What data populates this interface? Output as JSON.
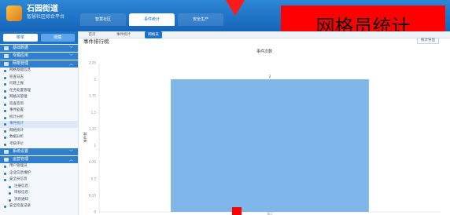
{
  "header": {
    "app_title": "石园街道",
    "app_subtitle": "智慧社区综合平台",
    "nav": [
      "智慧社区",
      "事件统计",
      "安全生产"
    ],
    "active_nav": 1
  },
  "overlay": {
    "banner_text": "网格员统计",
    "banner_color": "#ff0000"
  },
  "sidebar": {
    "tabs": [
      "菜单",
      "收藏"
    ],
    "sections": [
      {
        "title": "基础数据",
        "items": []
      },
      {
        "title": "专题应用",
        "items": []
      },
      {
        "title": "网格管理",
        "items": [
          {
            "label": "网格基础信息"
          },
          {
            "label": "巡查日志"
          },
          {
            "label": "问题上报"
          },
          {
            "label": "任务处置管理"
          },
          {
            "label": "网格员管理"
          },
          {
            "label": "巡查签到"
          },
          {
            "label": "事件处置"
          },
          {
            "label": "统计分析"
          },
          {
            "label": "事件统计",
            "active": true
          },
          {
            "label": "网格统计"
          },
          {
            "label": "数据分析"
          },
          {
            "label": "考核评价"
          }
        ]
      },
      {
        "title": "系统设置",
        "items": []
      },
      {
        "title": "运营管理",
        "items": [
          {
            "label": "用户管理员"
          },
          {
            "label": "企业信息维护"
          },
          {
            "label": "安全员信息"
          },
          {
            "label": "注册信息",
            "sub": true
          },
          {
            "label": "审核信息",
            "sub": true
          },
          {
            "label": "消息通知",
            "sub": true
          },
          {
            "label": "安全检查记录"
          }
        ]
      }
    ]
  },
  "main": {
    "subtabs": [
      "首页",
      "事件统计",
      "网格员"
    ],
    "active_subtab": 2,
    "panel_title": "事件排行榜",
    "export_label": "统计导出"
  },
  "chart_data": {
    "type": "bar",
    "title": "事件次数",
    "categories": [
      "张三"
    ],
    "values": [
      2
    ],
    "ylabel": "事件数",
    "ylim": [
      0,
      2.25
    ],
    "yticks": [
      0,
      0.25,
      0.5,
      0.75,
      1,
      1.25,
      1.5,
      1.75,
      2,
      2.25
    ],
    "bar_color": "#7fb6e9",
    "data_labels": true,
    "grid": false
  }
}
